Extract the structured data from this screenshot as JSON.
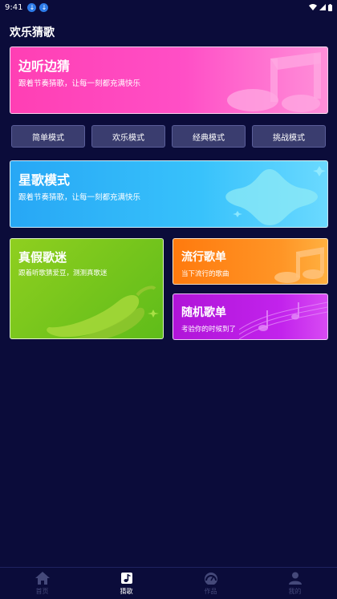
{
  "status_bar": {
    "time": "9:41"
  },
  "header": {
    "title": "欢乐猜歌"
  },
  "cards": {
    "listen_guess": {
      "title": "边听边猜",
      "subtitle": "跟着节奏猜歌，让每一刻都充满快乐"
    },
    "star_mode": {
      "title": "星歌模式",
      "subtitle": "跟着节奏猜歌，让每一刻都充满快乐"
    },
    "true_false": {
      "title": "真假歌迷",
      "subtitle": "跟着听歌猜爱豆，测测真歌迷"
    },
    "popular": {
      "title": "流行歌单",
      "subtitle": "当下流行的歌曲"
    },
    "random": {
      "title": "随机歌单",
      "subtitle": "考验你的时候到了"
    }
  },
  "modes": [
    "简单模式",
    "欢乐模式",
    "经典模式",
    "挑战模式"
  ],
  "tabbar": {
    "items": [
      {
        "label": "首页",
        "icon": "home-icon",
        "active": false
      },
      {
        "label": "猜歌",
        "icon": "music-note-icon",
        "active": true
      },
      {
        "label": "作品",
        "icon": "gauge-icon",
        "active": false
      },
      {
        "label": "我的",
        "icon": "person-icon",
        "active": false
      }
    ]
  },
  "colors": {
    "background": "#0b0c3a",
    "pink": "#ff3fb4",
    "blue": "#27a7f5",
    "green": "#6fc41c",
    "orange": "#ff8a1a",
    "purple": "#bf1ee8",
    "mode_button": "#3a3d6f"
  }
}
